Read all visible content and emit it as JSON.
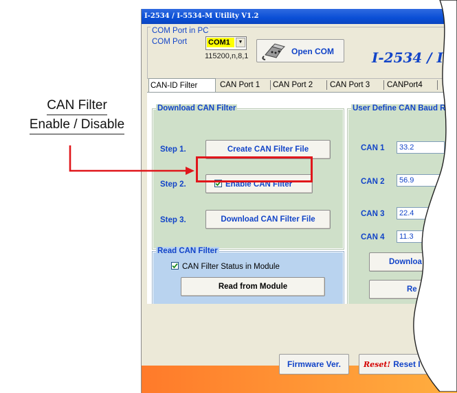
{
  "callout": {
    "line1": "CAN Filter",
    "line2": "Enable / Disable"
  },
  "window": {
    "title": "I-2534 / I-5534-M Utility V1.2"
  },
  "com_group": {
    "label": "COM Port in PC",
    "port_label": "COM Port",
    "port_value": "COM1",
    "baud": "115200,n,8,1",
    "open_button": "Open COM",
    "product_title": "I-2534 / I-5"
  },
  "tabs": [
    "CAN-ID Filter",
    "CAN Port 1",
    "CAN Port 2",
    "CAN Port 3",
    "CANPort4"
  ],
  "download_group": {
    "label": "Download CAN Filter",
    "step1_label": "Step 1.",
    "step1_button": "Create CAN Filter File",
    "step2_label": "Step 2.",
    "enable_label": "Enable CAN Filter",
    "enable_checked": true,
    "step3_label": "Step 3.",
    "step3_button": "Download CAN Filter File"
  },
  "read_group": {
    "label": "Read CAN Filter",
    "status_label": "CAN Filter Status in Module",
    "status_checked": true,
    "read_button": "Read from Module"
  },
  "baud_group": {
    "label": "User Define CAN Baud R",
    "rows": [
      {
        "label": "CAN 1",
        "value": "33.2"
      },
      {
        "label": "CAN 2",
        "value": "56.9"
      },
      {
        "label": "CAN 3",
        "value": "22.4"
      },
      {
        "label": "CAN 4",
        "value": "11.3"
      }
    ],
    "download_button": "Downloa",
    "read_button": "Re"
  },
  "footer": {
    "firmware_button": "Firmware Ver.",
    "reset_icon_text": "Reset!",
    "reset_button": "Reset I"
  },
  "colors": {
    "accent_blue": "#1244c8",
    "highlight_red": "#e0161b",
    "panel_green": "#cfe0c9",
    "panel_blue": "#b9d3ef"
  }
}
